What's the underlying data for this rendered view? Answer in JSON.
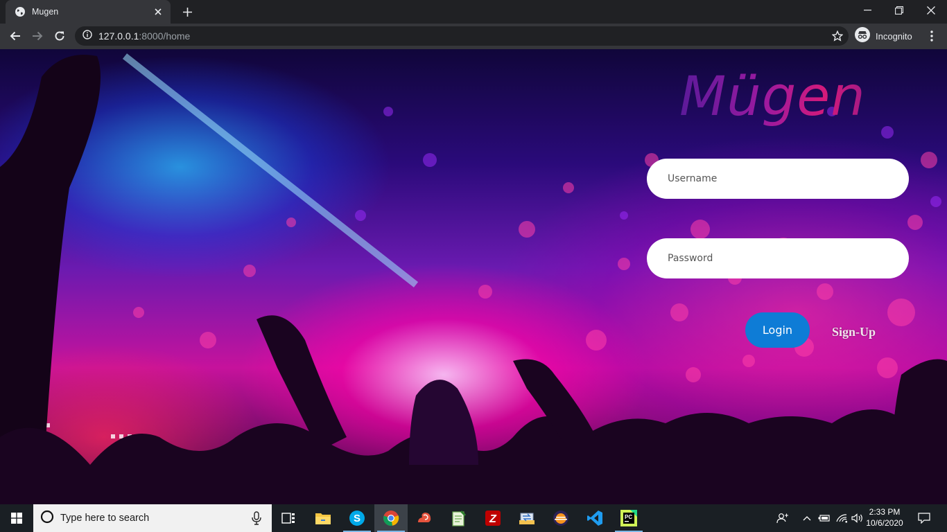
{
  "browser": {
    "tab": {
      "title": "Mugen"
    },
    "address": {
      "host": "127.0.0.1",
      "path": ":8000/home"
    },
    "profile": {
      "label": "Incognito"
    }
  },
  "page": {
    "logo": "Mügen",
    "username": {
      "placeholder": "Username",
      "value": ""
    },
    "password": {
      "placeholder": "Password",
      "value": ""
    },
    "login_label": "Login",
    "signup_label": "Sign-Up",
    "colors": {
      "login_button": "#0e7cd6",
      "logo_gradient_start": "#5b1a9a",
      "logo_gradient_end": "#d41a7a"
    }
  },
  "taskbar": {
    "search_placeholder": "Type here to search",
    "apps": [
      "task-view",
      "file-explorer",
      "skype",
      "chrome",
      "snail-app",
      "notepad-plus",
      "filezilla",
      "ftp-transfer",
      "eclipse",
      "vscode",
      "pycharm"
    ],
    "clock": {
      "time": "2:33 PM",
      "date": "10/6/2020"
    }
  }
}
